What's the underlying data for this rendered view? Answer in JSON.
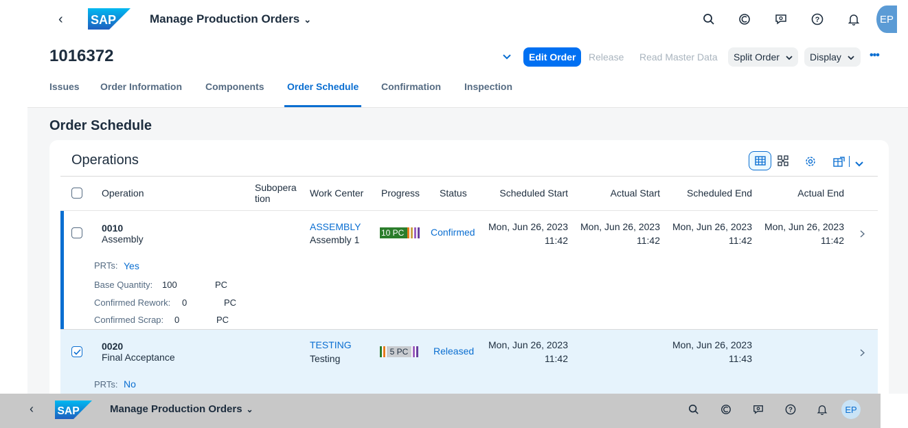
{
  "shell": {
    "app_title": "Manage Production Orders",
    "avatar_initials": "EP"
  },
  "header": {
    "object_id": "1016372",
    "actions": {
      "edit_order": "Edit Order",
      "release": "Release",
      "read_master_data": "Read Master Data",
      "split_order": "Split Order",
      "display": "Display"
    },
    "more": "•••"
  },
  "tabs": [
    "Issues",
    "Order Information",
    "Components",
    "Order Schedule",
    "Confirmation",
    "Inspection"
  ],
  "selected_tab": "Order Schedule",
  "section": {
    "title": "Order Schedule",
    "card_title": "Operations"
  },
  "table": {
    "columns": {
      "operation": "Operation",
      "suboperation": "Subopera\ntion",
      "work_center": "Work Center",
      "progress": "Progress",
      "status": "Status",
      "scheduled_start": "Scheduled Start",
      "actual_start": "Actual Start",
      "scheduled_end": "Scheduled End",
      "actual_end": "Actual End"
    },
    "rows": [
      {
        "operation_no": "0010",
        "operation_desc": "Assembly",
        "work_center_id": "ASSEMBLY",
        "work_center_desc": "Assembly 1",
        "progress_label": "10 PC",
        "status": "Confirmed",
        "scheduled_start_date": "Mon, Jun 26, 2023",
        "scheduled_start_time": "11:42",
        "actual_start_date": "Mon, Jun 26, 2023",
        "actual_start_time": "11:42",
        "scheduled_end_date": "Mon, Jun 26, 2023",
        "scheduled_end_time": "11:42",
        "actual_end_date": "Mon, Jun 26, 2023",
        "actual_end_time": "11:42",
        "selected": false,
        "details": {
          "prts_label": "PRTs:",
          "prts_value": "Yes",
          "base_qty_label": "Base Quantity:",
          "base_qty_value": "100",
          "base_qty_unit": "PC",
          "conf_rework_label": "Confirmed Rework:",
          "conf_rework_value": "0",
          "conf_rework_unit": "PC",
          "conf_scrap_label": "Confirmed Scrap:",
          "conf_scrap_value": "0",
          "conf_scrap_unit": "PC"
        }
      },
      {
        "operation_no": "0020",
        "operation_desc": "Final Acceptance",
        "work_center_id": "TESTING",
        "work_center_desc": "Testing",
        "progress_label": "5 PC",
        "status": "Released",
        "scheduled_start_date": "Mon, Jun 26, 2023",
        "scheduled_start_time": "11:42",
        "actual_start_date": "",
        "actual_start_time": "",
        "scheduled_end_date": "Mon, Jun 26, 2023",
        "scheduled_end_time": "11:43",
        "actual_end_date": "",
        "actual_end_time": "",
        "selected": true,
        "details": {
          "prts_label": "PRTs:",
          "prts_value": "No"
        }
      }
    ]
  },
  "colors": {
    "brand_blue": "#0a6ed1",
    "emphasized_button": "#0070f2",
    "progress_green": "#2b7d2b",
    "selected_row": "#e6f3fc"
  },
  "icons": [
    "back-icon",
    "search-icon",
    "copilot-icon",
    "feedback-icon",
    "help-icon",
    "bell-icon",
    "grid-view-icon",
    "network-view-icon",
    "settings-icon",
    "export-icon",
    "chevron-down-icon",
    "chevron-right-icon"
  ]
}
